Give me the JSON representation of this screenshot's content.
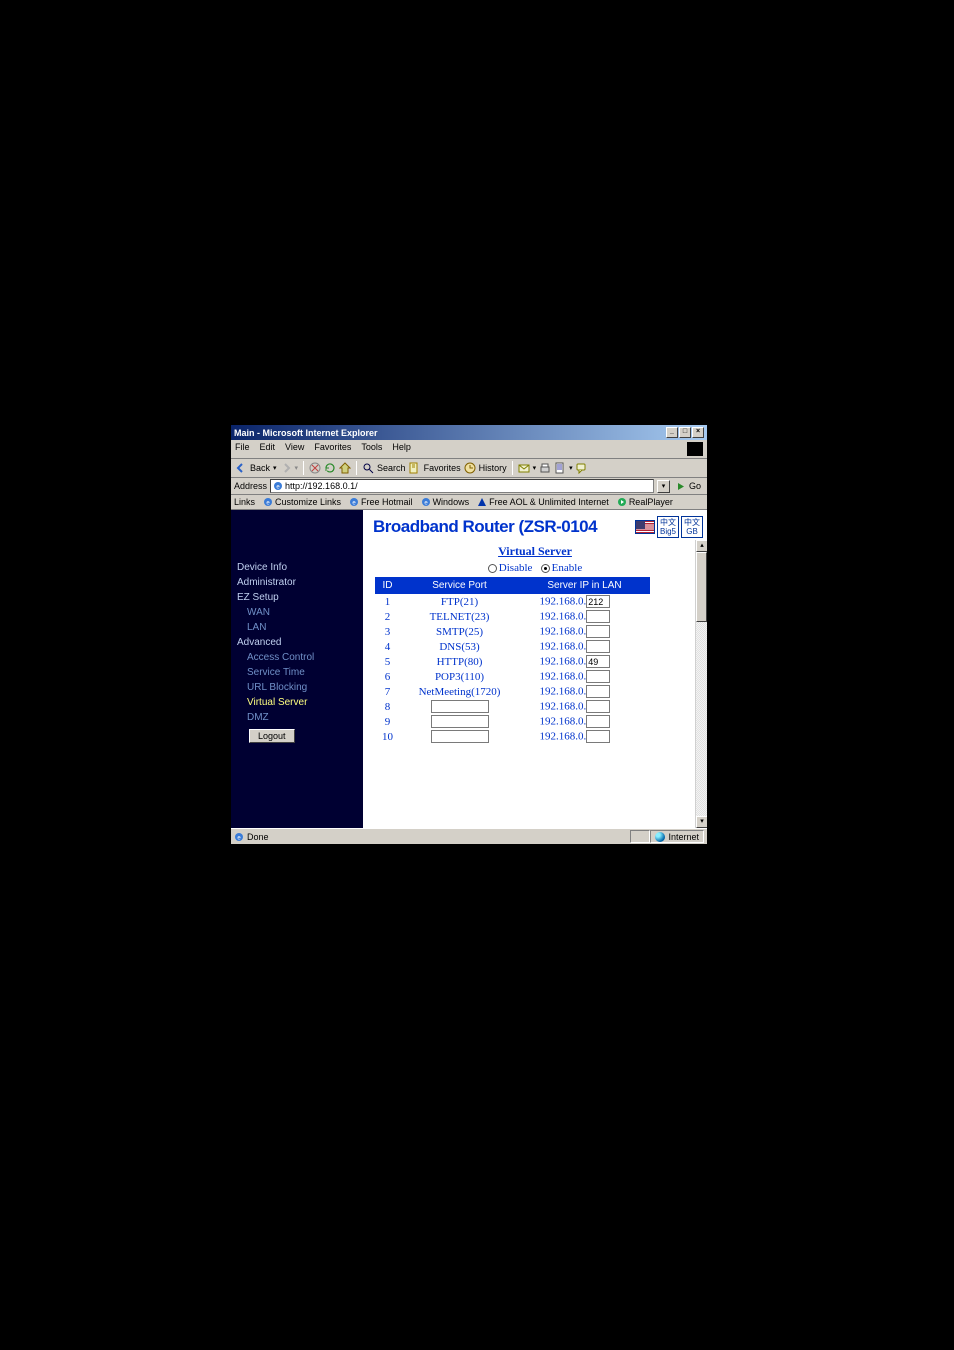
{
  "window": {
    "title": "Main - Microsoft Internet Explorer"
  },
  "menu": {
    "file": "File",
    "edit": "Edit",
    "view": "View",
    "favorites": "Favorites",
    "tools": "Tools",
    "help": "Help"
  },
  "toolbar": {
    "back": "Back",
    "search": "Search",
    "favorites": "Favorites",
    "history": "History"
  },
  "address": {
    "label": "Address",
    "url": "http://192.168.0.1/",
    "go": "Go"
  },
  "linksbar": {
    "label": "Links",
    "customize": "Customize Links",
    "hotmail": "Free Hotmail",
    "windows": "Windows",
    "aol": "Free AOL & Unlimited Internet",
    "realplayer": "RealPlayer"
  },
  "header": {
    "brand": "Broadband Router (ZSR-0104",
    "lang1_a": "中文",
    "lang1_b": "Big5",
    "lang2_a": "中文",
    "lang2_b": "GB"
  },
  "sidebar": {
    "device_info": "Device Info",
    "administrator": "Administrator",
    "ez_setup": "EZ Setup",
    "wan": "WAN",
    "lan": "LAN",
    "advanced": "Advanced",
    "access_control": "Access Control",
    "service_time": "Service Time",
    "url_blocking": "URL Blocking",
    "virtual_server": "Virtual Server",
    "dmz": "DMZ",
    "logout": "Logout"
  },
  "page": {
    "title": "Virtual Server",
    "disable": "Disable",
    "enable": "Enable",
    "th_id": "ID",
    "th_port": "Service Port",
    "th_ip": "Server IP in LAN",
    "ip_prefix": "192.168.0.",
    "rows": [
      {
        "id": "1",
        "port": "FTP(21)",
        "last": "212"
      },
      {
        "id": "2",
        "port": "TELNET(23)",
        "last": ""
      },
      {
        "id": "3",
        "port": "SMTP(25)",
        "last": ""
      },
      {
        "id": "4",
        "port": "DNS(53)",
        "last": ""
      },
      {
        "id": "5",
        "port": "HTTP(80)",
        "last": "49"
      },
      {
        "id": "6",
        "port": "POP3(110)",
        "last": ""
      },
      {
        "id": "7",
        "port": "NetMeeting(1720)",
        "last": ""
      },
      {
        "id": "8",
        "port": "",
        "last": ""
      },
      {
        "id": "9",
        "port": "",
        "last": ""
      },
      {
        "id": "10",
        "port": "",
        "last": ""
      }
    ]
  },
  "status": {
    "done": "Done",
    "zone": "Internet"
  }
}
